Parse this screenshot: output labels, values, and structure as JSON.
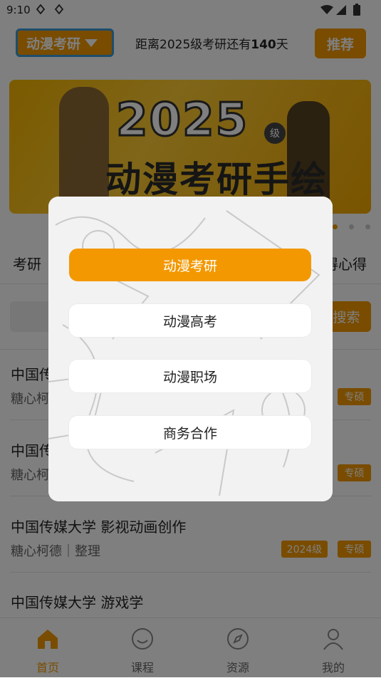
{
  "status_bar": {
    "time": "9:10"
  },
  "header": {
    "track_label": "动漫考研",
    "countdown_prefix": "距离2025级考研还有",
    "countdown_days": "140",
    "countdown_suffix": "天",
    "recommend_label": "推荐"
  },
  "banner": {
    "year": "2025",
    "grade": "级",
    "title": "动漫考研手绘"
  },
  "tabs": {
    "left": "考研",
    "right": "得心得"
  },
  "search": {
    "button_label": "搜索"
  },
  "list": [
    {
      "title": "中国传",
      "sub": "糖心柯",
      "tags": [
        "专硕"
      ]
    },
    {
      "title": "中国传",
      "sub": "糖心柯",
      "tags": [
        "专硕"
      ]
    },
    {
      "title": "中国传媒大学 影视动画创作",
      "sub": "糖心柯德｜整理",
      "tags": [
        "2024级",
        "专硕"
      ]
    },
    {
      "title": "中国传媒大学 游戏学",
      "sub": "",
      "tags": []
    }
  ],
  "tabbar": [
    {
      "label": "首页",
      "icon": "home-icon",
      "active": true
    },
    {
      "label": "课程",
      "icon": "smile-icon",
      "active": false
    },
    {
      "label": "资源",
      "icon": "compass-icon",
      "active": false
    },
    {
      "label": "我的",
      "icon": "user-icon",
      "active": false
    }
  ],
  "modal": {
    "options": [
      {
        "label": "动漫考研",
        "selected": true
      },
      {
        "label": "动漫高考",
        "selected": false
      },
      {
        "label": "动漫职场",
        "selected": false
      },
      {
        "label": "商务合作",
        "selected": false
      }
    ]
  },
  "colors": {
    "accent": "#f39800",
    "overlay": "rgba(0,0,0,0.5)"
  }
}
